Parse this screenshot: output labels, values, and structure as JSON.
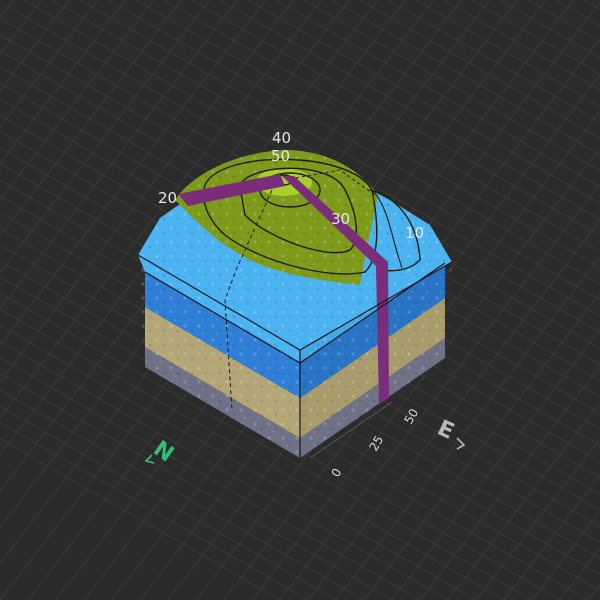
{
  "colors": {
    "background": "#2b2b2b",
    "grid": "#3a3a3a",
    "north": "#2fbf7a",
    "east": "#b9b9b9",
    "dike": "#7a2e7a",
    "summit": "#a8cf2a",
    "hill": "#7d9a1a",
    "lake": "#4bb3f0",
    "layer_water": "#2f7fd6",
    "layer_sand": "#b3a777",
    "layer_base": "#6f7286"
  },
  "model": {
    "contour_labels": [
      "40",
      "50",
      "20",
      "30",
      "10"
    ]
  },
  "axes": {
    "east_ticks": [
      "0",
      "25",
      "50"
    ],
    "north_label": "N",
    "east_label": "E",
    "north_icon": "north-arrow-icon",
    "east_icon": "east-arrow-icon"
  }
}
